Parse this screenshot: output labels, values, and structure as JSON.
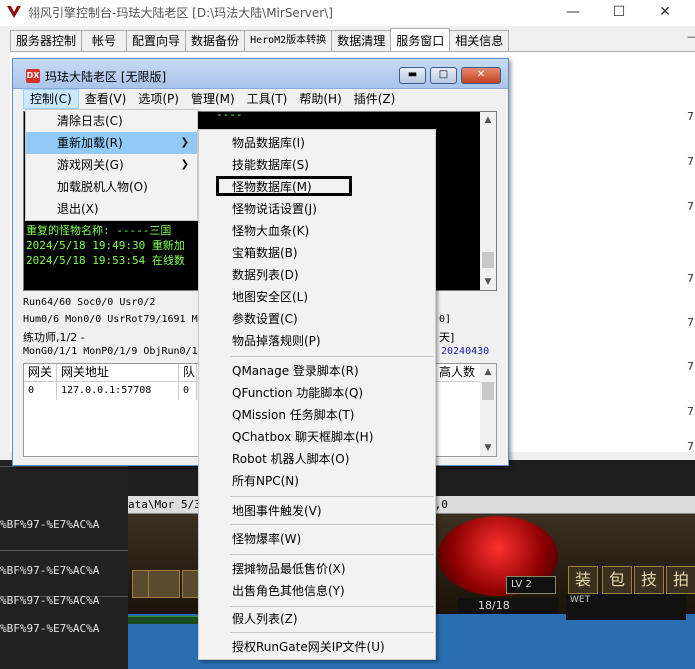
{
  "main_window": {
    "title": "翎风引擎控制台-玛珐大陆老区 [D:\\玛法大陆\\MirServer\\]",
    "tabs": [
      "服务器控制",
      "帐号",
      "配置向导",
      "数据备份",
      "HeroM2版本转换",
      "数据清理",
      "服务窗口",
      "相关信息"
    ],
    "active_tab": "服务窗口",
    "right_edge_digits": [
      "—",
      "7",
      "7",
      "7",
      "7",
      "7",
      "7",
      "7",
      "7"
    ]
  },
  "inner_window": {
    "title": "玛珐大陆老区 [无限版]",
    "icon_label": "DX",
    "menus": [
      "控制(C)",
      "查看(V)",
      "选项(P)",
      "管理(M)",
      "工具(T)",
      "帮助(H)",
      "插件(Z)"
    ],
    "active_menu": "控制(C)",
    "log_top": "----",
    "log_lines": [
      "重复的怪物名称: -----三国",
      "2024/5/18 19:49:30 重新加",
      "2024/5/18 19:53:54 在线数"
    ],
    "status_lines": [
      "Run64/60 Soc0/0 Usr0/2",
      "Hum0/6 Mon0/0 UsrRot79/1691 M",
      "练功师,1/2 -",
      "MonG0/1/1 MonP0/1/9 ObjRun0/1"
    ],
    "status_right": [
      "0]",
      "天]",
      "20240430"
    ],
    "grid_headers": [
      "网关",
      "网关地址",
      "队",
      "高人数"
    ],
    "grid_rows": [
      [
        "0",
        "127.0.0.1:57708",
        "0"
      ]
    ]
  },
  "control_menu": {
    "items": [
      "清除日志(C)",
      "重新加载(R)",
      "游戏网关(G)",
      "加载脱机人物(O)",
      "退出(X)"
    ],
    "highlighted": "重新加载(R)",
    "has_submenu": [
      "重新加载(R)",
      "游戏网关(G)"
    ]
  },
  "reload_submenu": {
    "groups": [
      [
        "物品数据库(I)",
        "技能数据库(S)",
        "怪物数据库(M)",
        "怪物说话设置(J)",
        "怪物大血条(K)",
        "宝箱数据(B)",
        "数据列表(D)",
        "地图安全区(L)",
        "参数设置(C)",
        "物品掉落规则(P)"
      ],
      [
        "QManage 登录脚本(R)",
        "QFunction 功能脚本(Q)",
        "QMission 任务脚本(T)",
        "QChatbox 聊天框脚本(H)",
        "Robot 机器人脚本(O)",
        "所有NPC(N)"
      ],
      [
        "地图事件触发(V)"
      ],
      [
        "怪物爆率(W)"
      ],
      [
        "摆摊物品最低售价(X)",
        "出售角色其他信息(Y)"
      ],
      [
        "假人列表(Z)"
      ],
      [
        "授权RunGate网关IP文件(U)"
      ]
    ],
    "boxed_item": "怪物数据库(M)"
  },
  "background": {
    "left_lines": [
      "%BF%97-%E7%AC%A",
      "%BF%97-%E7%AC%A",
      "%BF%97-%E7%AC%A",
      "%BF%97-%E7%AC%A"
    ],
    "game_band_text": "ata\\Mor 5/34",
    "game_band_right": "0,0",
    "game_buttons": [
      "装",
      "包",
      "技",
      "拍"
    ],
    "level": "LV 2",
    "hp": "18/18",
    "wet_label": "WET"
  },
  "colors": {
    "log_text": "#7fff50",
    "menu_highlight": "#91c9f7",
    "status_blue": "#1a1aa8"
  }
}
